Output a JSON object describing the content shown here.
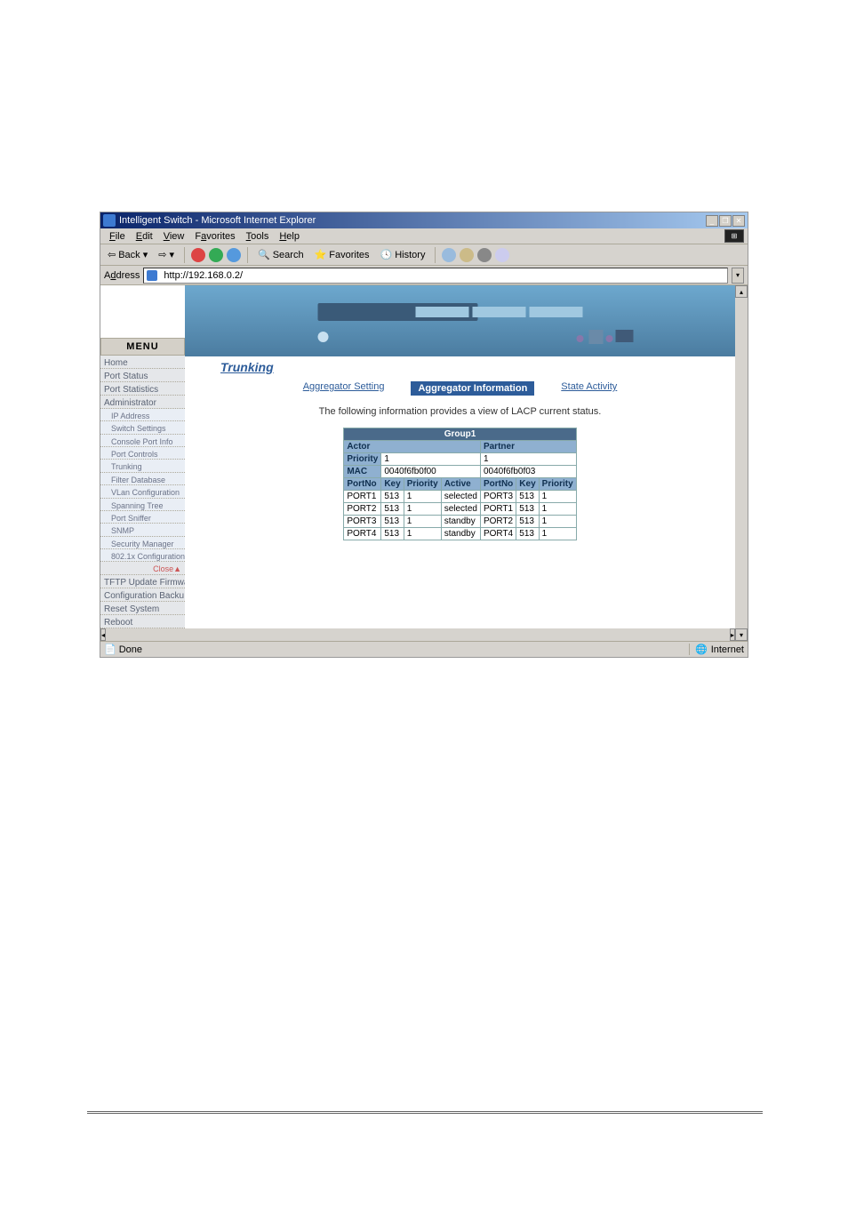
{
  "window": {
    "title": "Intelligent Switch - Microsoft Internet Explorer",
    "btn_min": "_",
    "btn_max": "❐",
    "btn_close": "✕",
    "flag": "⊞"
  },
  "menubar": {
    "file": "File",
    "edit": "Edit",
    "view": "View",
    "favorites": "Favorites",
    "tools": "Tools",
    "help": "Help"
  },
  "toolbar": {
    "back": "Back",
    "fwd_arrow": "→",
    "stop": "",
    "refresh": "",
    "home": "",
    "search": "Search",
    "favorites": "Favorites",
    "history": "History",
    "mail": "",
    "print": "",
    "edit": "",
    "discuss": ""
  },
  "address": {
    "label": "Address",
    "url": "http://192.168.0.2/"
  },
  "sidebar": {
    "menu_header": "MENU",
    "items": [
      "Home",
      "Port Status",
      "Port Statistics",
      "Administrator"
    ],
    "sub_items": [
      "IP Address",
      "Switch Settings",
      "Console Port Info",
      "Port Controls",
      "Trunking",
      "Filter Database",
      "VLan Configuration",
      "Spanning Tree",
      "Port Sniffer",
      "SNMP",
      "Security Manager",
      "802.1x Configuration"
    ],
    "close": "Close▲",
    "tail_items": [
      "TFTP Update Firmwa",
      "Configuration Backu",
      "Reset System",
      "Reboot"
    ]
  },
  "main": {
    "page_title": "Trunking",
    "tabs": {
      "setting": "Aggregator Setting",
      "info": "Aggregator Information",
      "state": "State Activity"
    },
    "info_text": "The following information provides a view of LACP current status.",
    "table": {
      "group": "Group1",
      "actor": "Actor",
      "partner": "Partner",
      "priority_label": "Priority",
      "mac_label": "MAC",
      "hdr_portno": "PortNo",
      "hdr_key": "Key",
      "hdr_priority": "Priority",
      "hdr_active": "Active",
      "actor_priority": "1",
      "partner_priority": "1",
      "actor_mac": "0040f6fb0f00",
      "partner_mac": "0040f6fb0f03",
      "rows": [
        {
          "a_port": "PORT1",
          "a_key": "513",
          "a_pri": "1",
          "a_act": "selected",
          "p_port": "PORT3",
          "p_key": "513",
          "p_pri": "1"
        },
        {
          "a_port": "PORT2",
          "a_key": "513",
          "a_pri": "1",
          "a_act": "selected",
          "p_port": "PORT1",
          "p_key": "513",
          "p_pri": "1"
        },
        {
          "a_port": "PORT3",
          "a_key": "513",
          "a_pri": "1",
          "a_act": "standby",
          "p_port": "PORT2",
          "p_key": "513",
          "p_pri": "1"
        },
        {
          "a_port": "PORT4",
          "a_key": "513",
          "a_pri": "1",
          "a_act": "standby",
          "p_port": "PORT4",
          "p_key": "513",
          "p_pri": "1"
        }
      ]
    }
  },
  "status": {
    "done": "Done",
    "zone": "Internet"
  }
}
